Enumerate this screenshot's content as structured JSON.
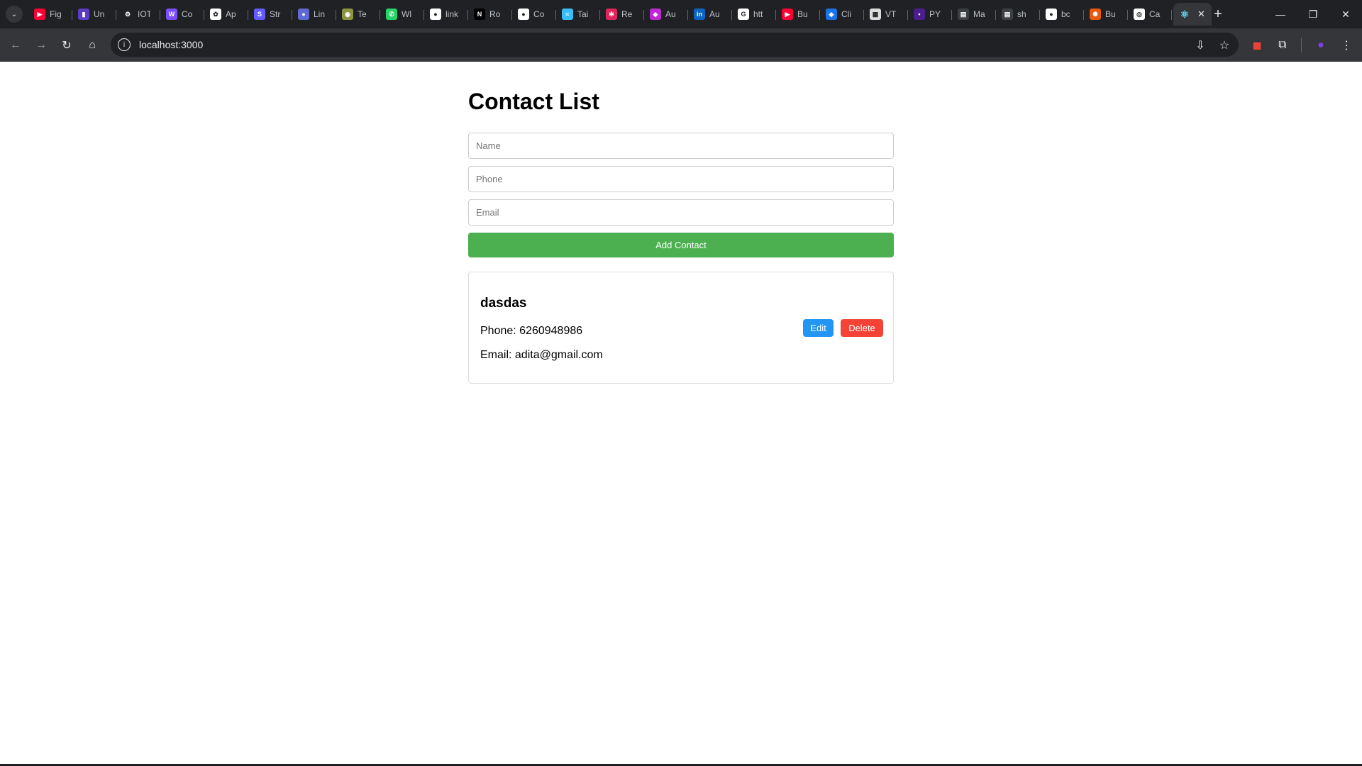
{
  "browser": {
    "tabs": [
      {
        "label": "Fig",
        "icon": "youtube-icon",
        "color": "#ff0033",
        "glyph": "▶"
      },
      {
        "label": "Un",
        "icon": "chart-icon",
        "color": "#5b3cc4",
        "glyph": "▮"
      },
      {
        "label": "IOT",
        "icon": "gear-icon",
        "color": "#202124",
        "glyph": "⚙"
      },
      {
        "label": "Co",
        "icon": "w-logo-icon",
        "color": "#7b4dff",
        "glyph": "W"
      },
      {
        "label": "Ap",
        "icon": "openai-icon",
        "color": "#ffffff",
        "glyph": "✿"
      },
      {
        "label": "Str",
        "icon": "s-logo-icon",
        "color": "#635bff",
        "glyph": "S"
      },
      {
        "label": "Lin",
        "icon": "linear-icon",
        "color": "#5e6ad2",
        "glyph": "●"
      },
      {
        "label": "Te",
        "icon": "globe-icon",
        "color": "#8d9440",
        "glyph": "◉"
      },
      {
        "label": "Wl",
        "icon": "whatsapp-icon",
        "color": "#25d366",
        "glyph": "✆"
      },
      {
        "label": "link",
        "icon": "github-icon",
        "color": "#ffffff",
        "glyph": "●"
      },
      {
        "label": "Ro",
        "icon": "n-logo-icon",
        "color": "#000000",
        "glyph": "N"
      },
      {
        "label": "Co",
        "icon": "github-icon",
        "color": "#ffffff",
        "glyph": "●"
      },
      {
        "label": "Tai",
        "icon": "tailwind-icon",
        "color": "#38bdf8",
        "glyph": "≈"
      },
      {
        "label": "Re",
        "icon": "react-icon",
        "color": "#e0245e",
        "glyph": "✻"
      },
      {
        "label": "Au",
        "icon": "shield-icon",
        "color": "#c026d3",
        "glyph": "◆"
      },
      {
        "label": "Au",
        "icon": "linkedin-icon",
        "color": "#0a66c2",
        "glyph": "in"
      },
      {
        "label": "htt",
        "icon": "google-icon",
        "color": "#ffffff",
        "glyph": "G"
      },
      {
        "label": "Bu",
        "icon": "youtube-icon",
        "color": "#ff0033",
        "glyph": "▶"
      },
      {
        "label": "Cli",
        "icon": "shield-icon",
        "color": "#1a73e8",
        "glyph": "◆"
      },
      {
        "label": "VT",
        "icon": "image-icon",
        "color": "#dddddd",
        "glyph": "▦"
      },
      {
        "label": "PY",
        "icon": "dot-icon",
        "color": "#4b1d8f",
        "glyph": "•"
      },
      {
        "label": "Ma",
        "icon": "page-icon",
        "color": "#3c4043",
        "glyph": "▤"
      },
      {
        "label": "sh",
        "icon": "page-icon",
        "color": "#3c4043",
        "glyph": "▤"
      },
      {
        "label": "bc",
        "icon": "github-icon",
        "color": "#ffffff",
        "glyph": "●"
      },
      {
        "label": "Bu",
        "icon": "asterisk-icon",
        "color": "#e8590c",
        "glyph": "✺"
      },
      {
        "label": "Ca",
        "icon": "target-icon",
        "color": "#ffffff",
        "glyph": "◎"
      }
    ],
    "active_tab": {
      "label": "",
      "icon": "react-icon",
      "glyph": "⚛",
      "close": "✕"
    },
    "new_tab": "+",
    "window_controls": {
      "minimize": "—",
      "restore": "❐",
      "close": "✕"
    },
    "url": "localhost:3000"
  },
  "app": {
    "title": "Contact List",
    "form": {
      "name_placeholder": "Name",
      "phone_placeholder": "Phone",
      "email_placeholder": "Email",
      "name_value": "",
      "phone_value": "",
      "email_value": "",
      "submit_label": "Add Contact"
    },
    "contacts": [
      {
        "name": "dasdas",
        "phone_text": "Phone: 6260948986",
        "email_text": "Email: adita@gmail.com",
        "edit_label": "Edit",
        "delete_label": "Delete"
      }
    ]
  },
  "colors": {
    "add_button": "#4caf50",
    "edit_button": "#2196f3",
    "delete_button": "#f44336",
    "chrome_dark": "#202124",
    "chrome_toolbar": "#35363a"
  }
}
